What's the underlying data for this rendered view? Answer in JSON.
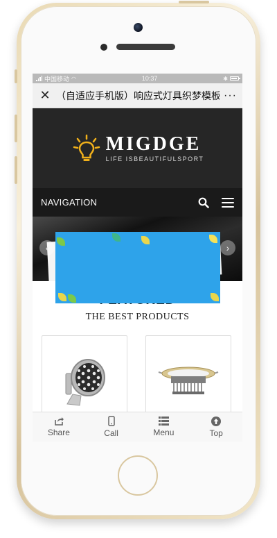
{
  "status_bar": {
    "carrier": "中国移动",
    "time": "10:37"
  },
  "browser_nav": {
    "title": "（自适应手机版）响应式灯具织梦模板...",
    "close_glyph": "✕",
    "more_glyph": "···"
  },
  "header": {
    "brand": "MIGDGE",
    "tagline": "LIFE ISBEAUTIFULSPORT",
    "accent_color": "#f2b11b"
  },
  "navigation": {
    "label": "NAVIGATION"
  },
  "banner": {
    "left_glyph": "‹",
    "right_glyph": "›"
  },
  "featured": {
    "title": "FEATURED",
    "subtitle": "THE BEST PRODUCTS",
    "products": [
      {
        "icon": "floodlight-icon"
      },
      {
        "icon": "downlight-icon"
      }
    ]
  },
  "popup": {
    "color": "#2ea3ea"
  },
  "bottom_bar": {
    "items": [
      {
        "label": "Share",
        "icon": "share-icon"
      },
      {
        "label": "Call",
        "icon": "phone-icon"
      },
      {
        "label": "Menu",
        "icon": "menu-list-icon"
      },
      {
        "label": "Top",
        "icon": "arrow-up-icon"
      }
    ]
  }
}
